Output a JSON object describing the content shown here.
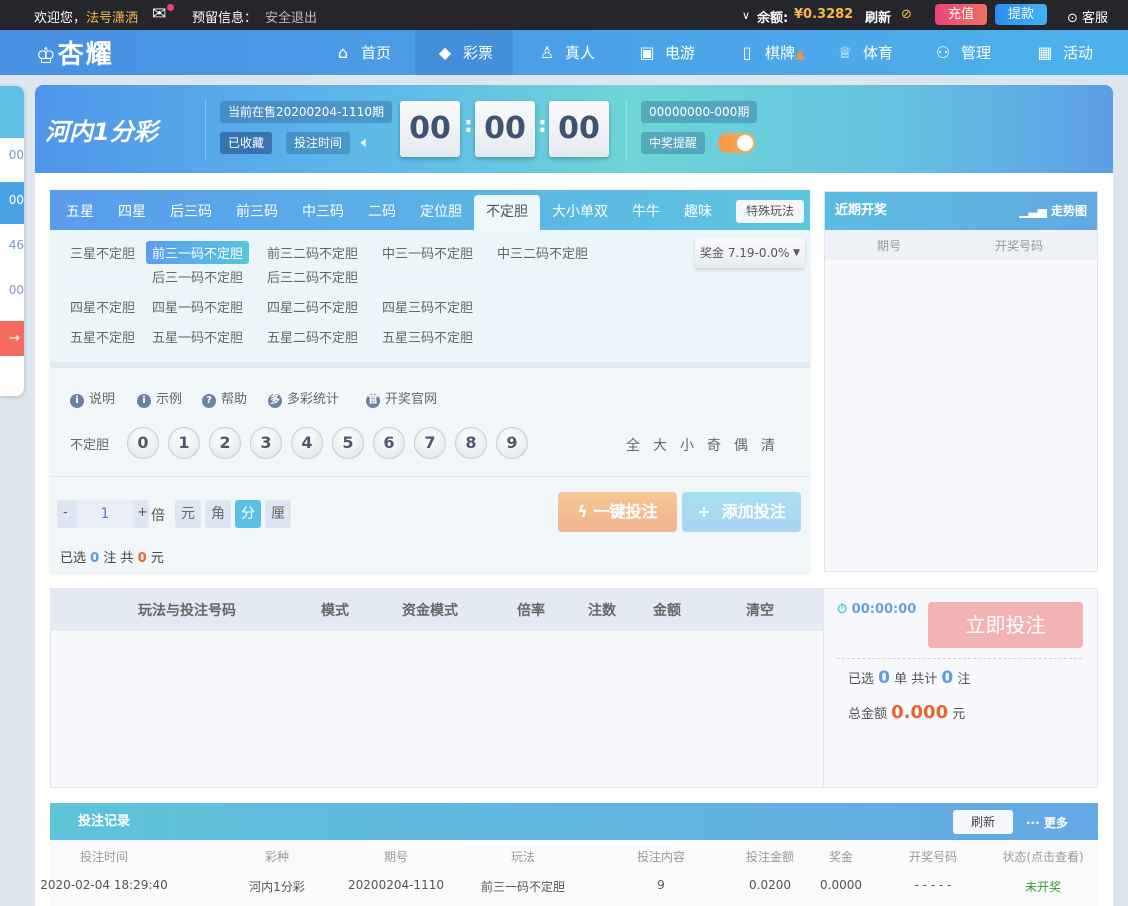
{
  "topbar": {
    "welcome": "欢迎您，",
    "username": "法号潇洒",
    "reserved": "预留信息：",
    "logout": "安全退出",
    "balance_label": "余额:",
    "balance": "¥0.3282",
    "refresh": "刷新",
    "recharge": "充值",
    "withdraw": "提款",
    "service": "客服"
  },
  "brand": {
    "logo": "杏耀"
  },
  "nav": [
    {
      "label": "首页",
      "icon": "home-icon",
      "glyph": "⌂"
    },
    {
      "label": "彩票",
      "icon": "ticket-icon",
      "glyph": "◆"
    },
    {
      "label": "真人",
      "icon": "person-icon",
      "glyph": "♙"
    },
    {
      "label": "电游",
      "icon": "slot-machine-icon",
      "glyph": "▣"
    },
    {
      "label": "棋牌",
      "icon": "mahjong-icon",
      "glyph": "▯"
    },
    {
      "label": "体育",
      "icon": "trophy-icon",
      "glyph": "♕"
    },
    {
      "label": "管理",
      "icon": "users-icon",
      "glyph": "⚇"
    },
    {
      "label": "活动",
      "icon": "gift-icon",
      "glyph": "▦"
    }
  ],
  "leftpanel": [
    "00",
    "00",
    "46",
    "00"
  ],
  "banner": {
    "logo": "河内1分彩",
    "current": "当前在售20200204-1110期",
    "favorited": "已收藏",
    "bet_time": "投注时间",
    "clock": [
      "00",
      "00",
      "00"
    ],
    "last_issue": "00000000-000期",
    "win_alert": "中奖提醒"
  },
  "tabs": [
    "五星",
    "四星",
    "后三码",
    "前三码",
    "中三码",
    "二码",
    "定位胆",
    "不定胆",
    "大小单双",
    "牛牛",
    "趣味"
  ],
  "active_tab": "不定胆",
  "special": "特殊玩法",
  "subplays": {
    "r1": [
      "三星不定胆",
      "前三一码不定胆",
      "前三二码不定胆",
      "中三一码不定胆",
      "中三二码不定胆"
    ],
    "r1b": [
      "后三一码不定胆",
      "后三二码不定胆"
    ],
    "r2": [
      "四星不定胆",
      "四星一码不定胆",
      "四星二码不定胆",
      "四星三码不定胆"
    ],
    "r3": [
      "五星不定胆",
      "五星一码不定胆",
      "五星二码不定胆",
      "五星三码不定胆"
    ]
  },
  "prize": "奖金 7.19-0.0%",
  "info_links": [
    {
      "i": "i",
      "label": "说明"
    },
    {
      "i": "i",
      "label": "示例"
    },
    {
      "i": "?",
      "label": "帮助"
    },
    {
      "i": "多",
      "label": "多彩统计"
    },
    {
      "i": "官",
      "label": "开奖官网"
    }
  ],
  "ball_label": "不定胆",
  "balls": [
    "0",
    "1",
    "2",
    "3",
    "4",
    "5",
    "6",
    "7",
    "8",
    "9"
  ],
  "quick": [
    "全",
    "大",
    "小",
    "奇",
    "偶",
    "清"
  ],
  "multiplier": {
    "minus": "-",
    "value": "1",
    "plus": "+",
    "unit": "倍"
  },
  "units": [
    "元",
    "角",
    "分",
    "厘"
  ],
  "active_unit": "分",
  "selected": {
    "pre": "已选",
    "count": "0",
    "mid": "注  共",
    "amount": "0",
    "post": "元"
  },
  "one_click": "一键投注",
  "add_bet": "添加投注",
  "recent": {
    "title": "近期开奖",
    "trend": "走势图",
    "cols": [
      "期号",
      "开奖号码"
    ]
  },
  "bet_table": {
    "cols": [
      "玩法与投注号码",
      "模式",
      "资金模式",
      "倍率",
      "注数",
      "金额",
      "清空"
    ]
  },
  "summary": {
    "timer": "00:00:00",
    "submit": "立即投注",
    "sel_pre": "已选",
    "orders": "0",
    "sel_mid": "单 共计",
    "bets": "0",
    "sel_post": "注",
    "total_label": "总金额",
    "total": "0.000",
    "total_unit": "元"
  },
  "records": {
    "title": "投注记录",
    "refresh": "刷新",
    "more": "更多",
    "cols": [
      "投注时间",
      "彩种",
      "期号",
      "玩法",
      "投注内容",
      "投注金额",
      "奖金",
      "开奖号码",
      "状态(点击查看)"
    ],
    "rows": [
      [
        "2020-02-04 18:29:40",
        "河内1分彩",
        "20200204-1110",
        "前三一码不定胆",
        "9",
        "0.0200",
        "0.0000",
        "- - - - -",
        "未开奖"
      ]
    ]
  }
}
